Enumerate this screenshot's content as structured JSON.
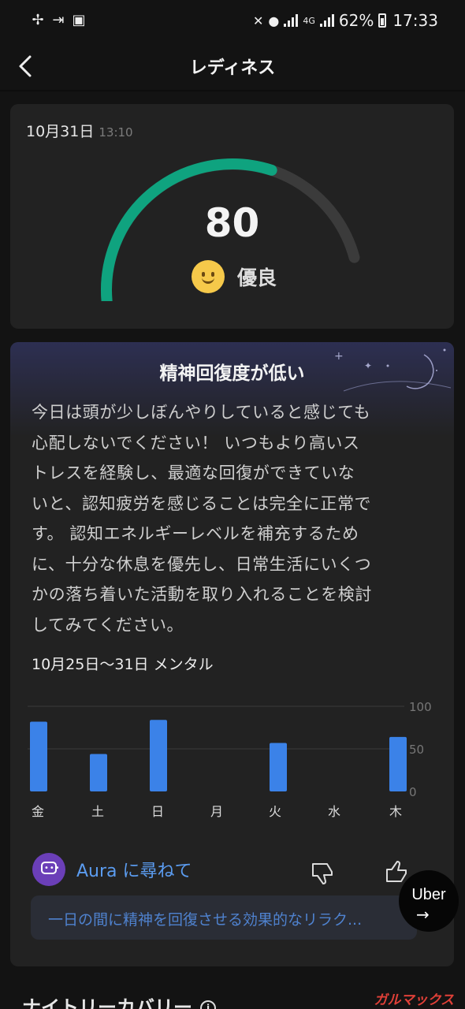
{
  "status_bar": {
    "battery": "62%",
    "time": "17:33",
    "network": "4G",
    "icons": [
      "fan-icon",
      "cast-icon",
      "gallery-icon",
      "mute-icon",
      "location-icon",
      "signal-icon",
      "battery-icon"
    ]
  },
  "header": {
    "title": "レディネス",
    "back_icon": "chevron-left-icon"
  },
  "score_card": {
    "date": "10月31日",
    "time": "13:10",
    "score": "80",
    "score_value": 80,
    "rating": "優良",
    "rating_icon": "smile-emoji-icon",
    "gauge_color": "#0fa37f",
    "track_color": "#3b3b3b"
  },
  "mental_card": {
    "title": "精神回復度が低い",
    "body_lines": [
      "今日は頭が少しぼんやりしていると感じても",
      "心配しないでください！ いつもより高いス",
      "トレスを経験し、最適な回復ができていな",
      "いと、認知疲労を感じることは完全に正常で",
      "す。 認知エネルギーレベルを補充するため",
      "に、十分な休息を優先し、日常生活にいくつ",
      "かの落ち着いた活動を取り入れることを検討",
      "してみてください。"
    ],
    "range_label": "10月25日〜31日 メンタル"
  },
  "chart_data": {
    "type": "bar",
    "categories": [
      "金",
      "土",
      "日",
      "月",
      "火",
      "水",
      "木"
    ],
    "values": [
      82,
      44,
      84,
      null,
      57,
      null,
      64
    ],
    "ylim": [
      0,
      100
    ],
    "y_ticks": [
      "100",
      "50",
      "0"
    ],
    "grid": true,
    "bar_color": "#3b82e8"
  },
  "aura": {
    "label": "Aura に尋ねて",
    "suggestion": "一日の間に精神を回復させる効果的なリラク...",
    "thumbs_down_icon": "thumbs-down-icon",
    "thumbs_up_icon": "thumbs-up-icon"
  },
  "uber_bubble": {
    "label": "Uber",
    "arrow_icon": "arrow-right-icon"
  },
  "next_section": {
    "title": "ナイトリーカバリー"
  },
  "watermark": "ガルマックス"
}
